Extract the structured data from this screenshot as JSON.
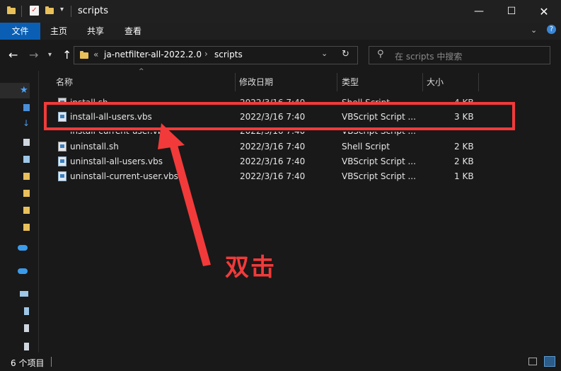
{
  "window": {
    "title": "scripts",
    "colors": {
      "accent": "#0a5fb4",
      "annotation": "#f23a3a",
      "background": "#191919"
    }
  },
  "ribbon": {
    "tabs": [
      {
        "label": "文件",
        "active": true
      },
      {
        "label": "主页"
      },
      {
        "label": "共享"
      },
      {
        "label": "查看"
      }
    ]
  },
  "address_bar": {
    "overflow": "«",
    "path": [
      "ja-netfilter-all-2022.2.0",
      "scripts"
    ],
    "separator": "›"
  },
  "search": {
    "placeholder": "在 scripts 中搜索"
  },
  "columns": {
    "name": "名称",
    "modified": "修改日期",
    "type": "类型",
    "size": "大小"
  },
  "files": [
    {
      "name": "install.sh",
      "modified": "2022/3/16 7:40",
      "type": "Shell Script",
      "size": "4 KB",
      "obscured": true
    },
    {
      "name": "install-all-users.vbs",
      "modified": "2022/3/16 7:40",
      "type": "VBScript Script ...",
      "size": "3 KB",
      "highlighted": true
    },
    {
      "name": "install-current-user.vbs",
      "modified": "2022/3/16 7:40",
      "type": "VBScript Script ...",
      "size": "",
      "obscured": true
    },
    {
      "name": "uninstall.sh",
      "modified": "2022/3/16 7:40",
      "type": "Shell Script",
      "size": "2 KB"
    },
    {
      "name": "uninstall-all-users.vbs",
      "modified": "2022/3/16 7:40",
      "type": "VBScript Script ...",
      "size": "2 KB"
    },
    {
      "name": "uninstall-current-user.vbs",
      "modified": "2022/3/16 7:40",
      "type": "VBScript Script ...",
      "size": "1 KB"
    }
  ],
  "status": {
    "count": "6 个项目"
  },
  "annotation": {
    "text": "双击"
  }
}
